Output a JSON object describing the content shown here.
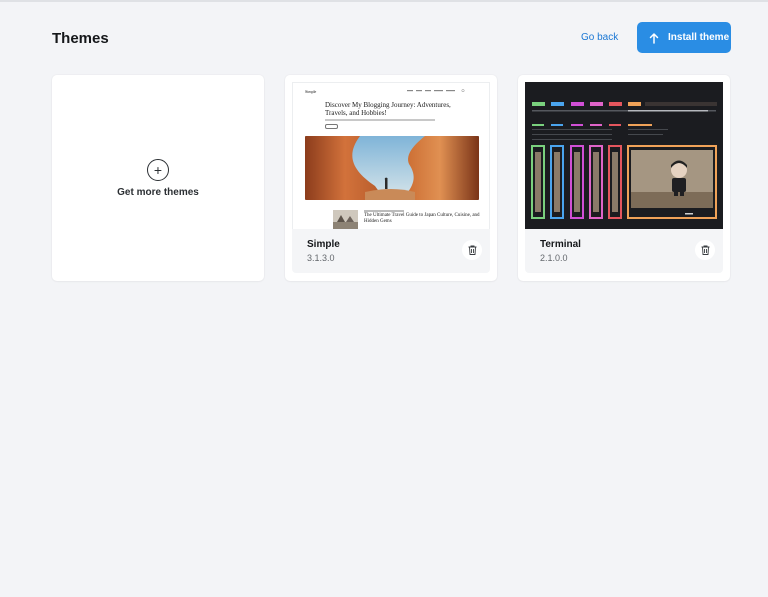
{
  "header": {
    "title": "Themes",
    "go_back": "Go back",
    "install_label": "Install theme"
  },
  "get_more": {
    "label": "Get more themes"
  },
  "themes": [
    {
      "name": "Simple",
      "version": "3.1.3.0",
      "preview": {
        "logo": "Simple",
        "hero_title": "Discover My Blogging Journey: Adventures, Travels, and Hobbies!",
        "post_title": "The Ultimate Travel Guide to Japan Culture, Cuisine, and Hidden Gems"
      }
    },
    {
      "name": "Terminal",
      "version": "2.1.0.0"
    }
  ],
  "colors": {
    "accent": "#2a8de4",
    "link": "#1a77d4",
    "background": "#f3f4f7"
  },
  "icons": [
    "plus-circle-icon",
    "arrow-up-icon",
    "trash-icon"
  ]
}
